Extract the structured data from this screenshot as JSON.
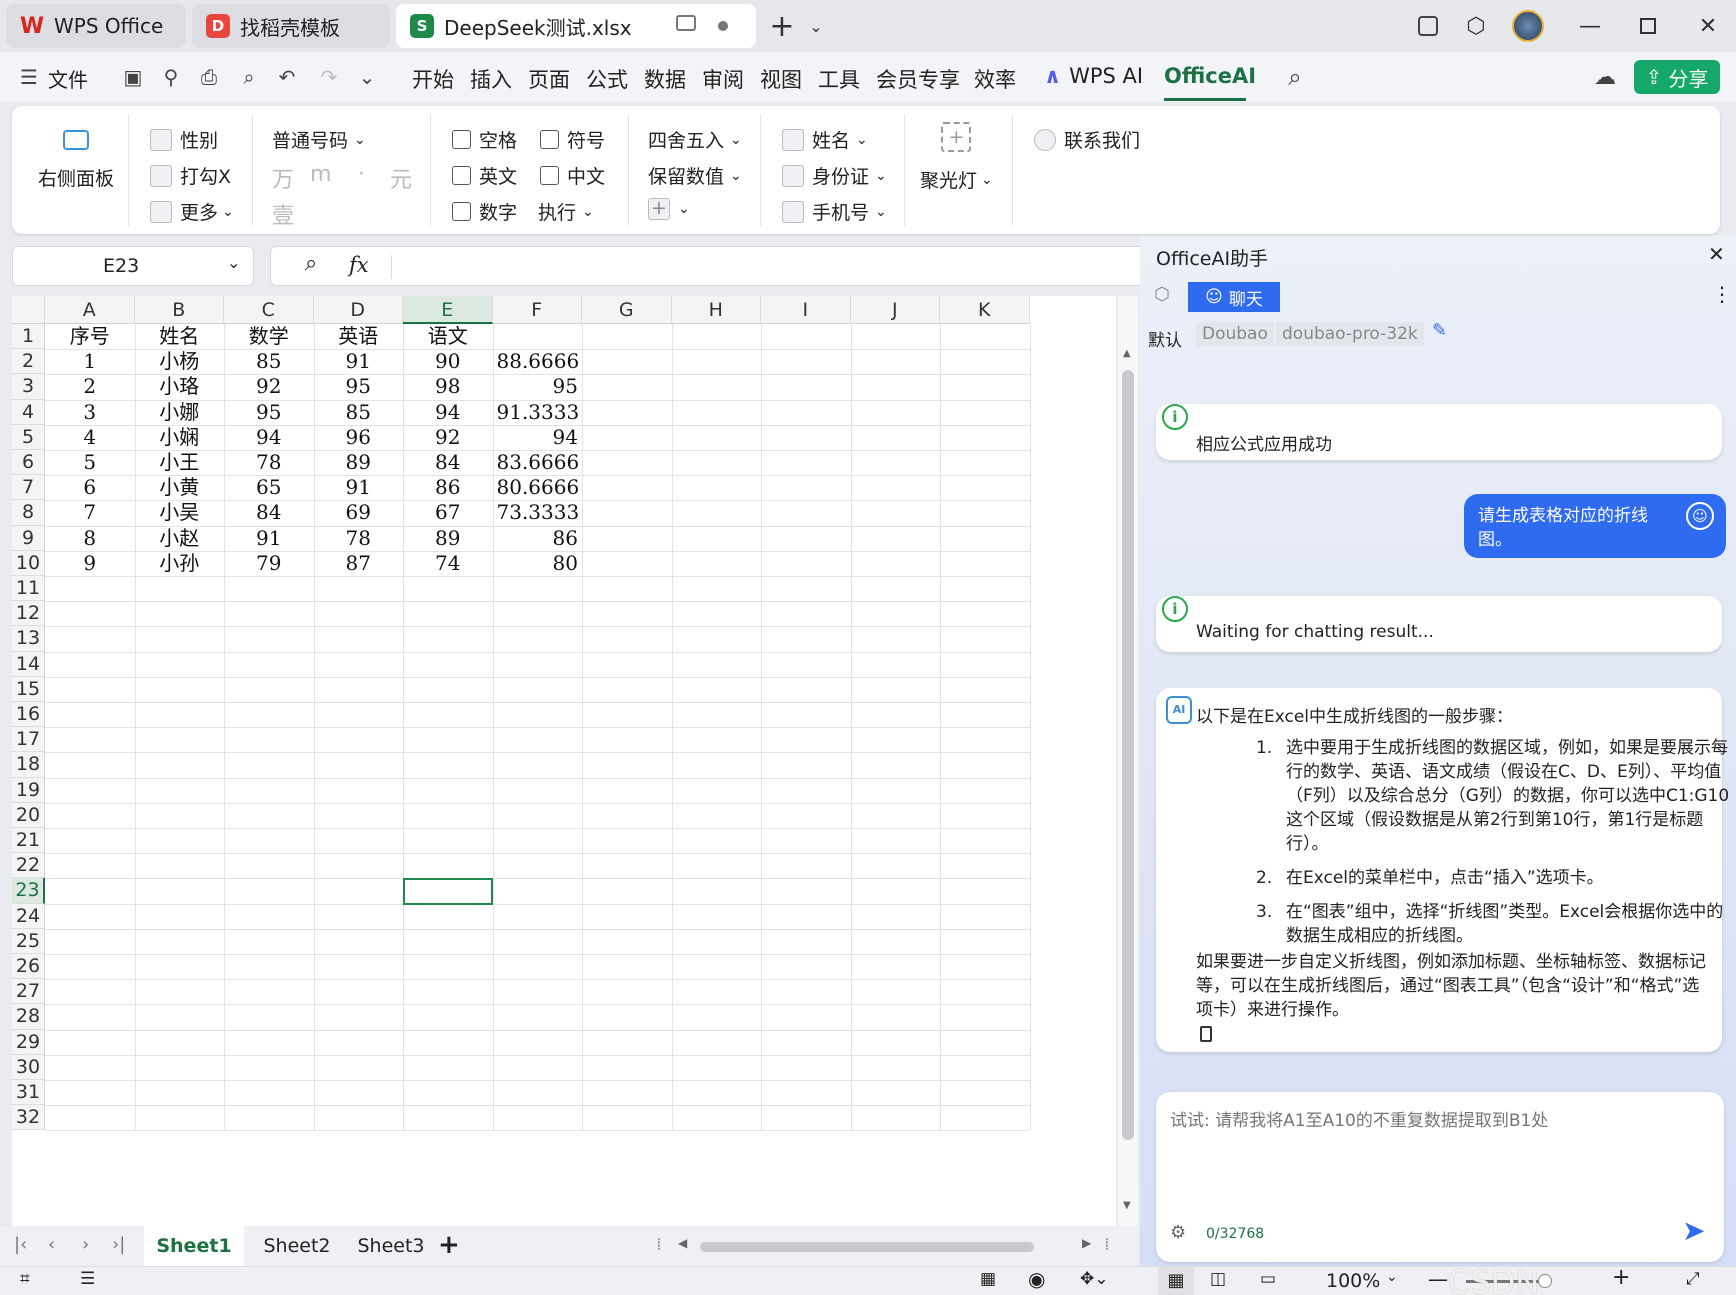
{
  "tabs": [
    {
      "label": "WPS Office",
      "icon": "wps-logo-icon"
    },
    {
      "label": "找稻壳模板",
      "icon": "docer-logo-icon"
    },
    {
      "label": "DeepSeek测试.xlsx",
      "icon": "spreadsheet-logo-icon",
      "active": true
    }
  ],
  "menu": {
    "file": "文件",
    "items": [
      "开始",
      "插入",
      "页面",
      "公式",
      "数据",
      "审阅",
      "视图",
      "工具",
      "会员专享",
      "效率"
    ],
    "wps_ai": "WPS AI",
    "office_ai": "OfficeAI",
    "share": "分享"
  },
  "ribbon": {
    "right_panel": "右侧面板",
    "gender": "性别",
    "checkx": "打勾X",
    "more": "更多",
    "normal_number": "普通号码",
    "unit_wan": "万",
    "unit_m": "m",
    "unit_dot": "·",
    "unit_yuan": "元",
    "unit_yi": "壹",
    "space": "空格",
    "symbol": "符号",
    "english": "英文",
    "chinese": "中文",
    "digit": "数字",
    "execute": "执行",
    "round": "四舍五入",
    "keep_value": "保留数值",
    "name": "姓名",
    "id_card": "身份证",
    "phone": "手机号",
    "spotlight": "聚光灯",
    "contact": "联系我们"
  },
  "formula_bar": {
    "name_box": "E23",
    "fx": "fx"
  },
  "grid": {
    "columns": [
      "A",
      "B",
      "C",
      "D",
      "E",
      "F",
      "G",
      "H",
      "I",
      "J",
      "K"
    ],
    "row_numbers": [
      "1",
      "2",
      "3",
      "4",
      "5",
      "6",
      "7",
      "8",
      "9",
      "10",
      "11",
      "12",
      "13",
      "14",
      "15",
      "16",
      "17",
      "18",
      "19",
      "20",
      "21",
      "22",
      "23",
      "24",
      "25",
      "26",
      "27",
      "28",
      "29",
      "30",
      "31",
      "32"
    ],
    "header_row": [
      "序号",
      "姓名",
      "数学",
      "英语",
      "语文"
    ],
    "rows": [
      [
        "1",
        "小杨",
        "85",
        "91",
        "90",
        "88.66667"
      ],
      [
        "2",
        "小珞",
        "92",
        "95",
        "98",
        "95"
      ],
      [
        "3",
        "小娜",
        "95",
        "85",
        "94",
        "91.33333"
      ],
      [
        "4",
        "小娴",
        "94",
        "96",
        "92",
        "94"
      ],
      [
        "5",
        "小王",
        "78",
        "89",
        "84",
        "83.66667"
      ],
      [
        "6",
        "小黄",
        "65",
        "91",
        "86",
        "80.66667"
      ],
      [
        "7",
        "小吴",
        "84",
        "69",
        "67",
        "73.33333"
      ],
      [
        "8",
        "小赵",
        "91",
        "78",
        "89",
        "86"
      ],
      [
        "9",
        "小孙",
        "79",
        "87",
        "74",
        "80"
      ]
    ],
    "selected_cell": "E23"
  },
  "sheet_tabs": [
    "Sheet1",
    "Sheet2",
    "Sheet3"
  ],
  "status": {
    "zoom": "100%"
  },
  "ai_panel": {
    "title": "OfficeAI助手",
    "chat_tab": "聊天",
    "model_default": "默认",
    "model_provider": "Doubao",
    "model_name": "doubao-pro-32k",
    "msg_success": "相应公式应用成功",
    "user_message": "请生成表格对应的折线图。",
    "msg_waiting": "Waiting for chatting result...",
    "answer_intro": "以下是在Excel中生成折线图的一般步骤：",
    "steps": [
      {
        "num": "1.",
        "text": "选中要用于生成折线图的数据区域，例如，如果是要展示每行的数学、英语、语文成绩（假设在C、D、E列）、平均值（F列）以及综合总分（G列）的数据，你可以选中C1:G10这个区域（假设数据是从第2行到第10行，第1行是标题行）。"
      },
      {
        "num": "2.",
        "text": "在Excel的菜单栏中，点击“插入”选项卡。"
      },
      {
        "num": "3.",
        "text": "在“图表”组中，选择“折线图”类型。Excel会根据你选中的数据生成相应的折线图。"
      }
    ],
    "answer_outro": "如果要进一步自定义折线图，例如添加标题、坐标轴标签、数据标记等，可以在生成折线图后，通过“图表工具”（包含“设计”和“格式”选项卡）来进行操作。",
    "input_placeholder": "试试: 请帮我将A1至A10的不重复数据提取到B1处",
    "char_count": "0/32768"
  },
  "watermark": "CSDN @Eastmount",
  "colors": {
    "accent_green": "#1e7145",
    "share_green": "#16a86b",
    "ai_blue": "#2f6bf0",
    "selection_green": "#1e8a4a"
  }
}
